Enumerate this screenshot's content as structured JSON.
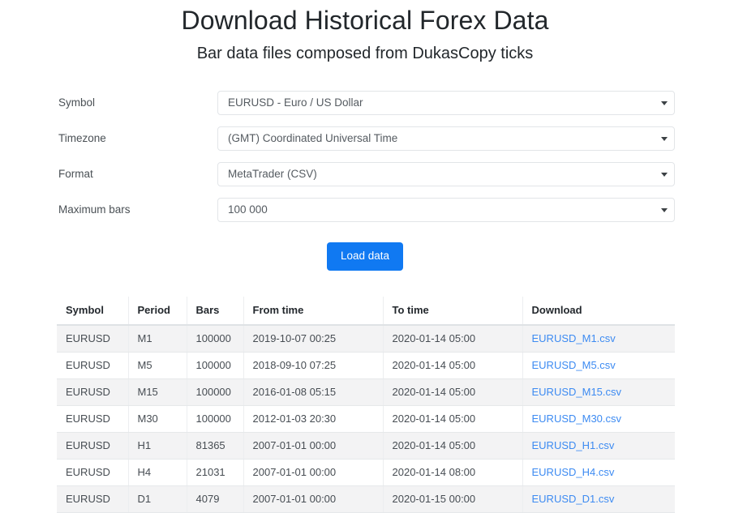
{
  "header": {
    "title": "Download Historical Forex Data",
    "subtitle": "Bar data files composed from DukasCopy ticks"
  },
  "form": {
    "fields": [
      {
        "label": "Symbol",
        "value": "EURUSD - Euro / US Dollar"
      },
      {
        "label": "Timezone",
        "value": "(GMT) Coordinated Universal Time"
      },
      {
        "label": "Format",
        "value": "MetaTrader (CSV)"
      },
      {
        "label": "Maximum bars",
        "value": "100 000"
      }
    ],
    "submit_label": "Load data"
  },
  "table": {
    "columns": [
      "Symbol",
      "Period",
      "Bars",
      "From time",
      "To time",
      "Download"
    ],
    "rows": [
      {
        "symbol": "EURUSD",
        "period": "M1",
        "bars": "100000",
        "from_time": "2019-10-07 00:25",
        "to_time": "2020-01-14 05:00",
        "download": "EURUSD_M1.csv"
      },
      {
        "symbol": "EURUSD",
        "period": "M5",
        "bars": "100000",
        "from_time": "2018-09-10 07:25",
        "to_time": "2020-01-14 05:00",
        "download": "EURUSD_M5.csv"
      },
      {
        "symbol": "EURUSD",
        "period": "M15",
        "bars": "100000",
        "from_time": "2016-01-08 05:15",
        "to_time": "2020-01-14 05:00",
        "download": "EURUSD_M15.csv"
      },
      {
        "symbol": "EURUSD",
        "period": "M30",
        "bars": "100000",
        "from_time": "2012-01-03 20:30",
        "to_time": "2020-01-14 05:00",
        "download": "EURUSD_M30.csv"
      },
      {
        "symbol": "EURUSD",
        "period": "H1",
        "bars": "81365",
        "from_time": "2007-01-01 00:00",
        "to_time": "2020-01-14 05:00",
        "download": "EURUSD_H1.csv"
      },
      {
        "symbol": "EURUSD",
        "period": "H4",
        "bars": "21031",
        "from_time": "2007-01-01 00:00",
        "to_time": "2020-01-14 08:00",
        "download": "EURUSD_H4.csv"
      },
      {
        "symbol": "EURUSD",
        "period": "D1",
        "bars": "4079",
        "from_time": "2007-01-01 00:00",
        "to_time": "2020-01-15 00:00",
        "download": "EURUSD_D1.csv"
      }
    ]
  },
  "colors": {
    "accent_button": "#1079f2",
    "link": "#3d8bf2",
    "row_stripe": "#f3f3f4",
    "page_background": "#ffffff"
  },
  "icons": {
    "select_arrow": "chevron-down-icon"
  }
}
